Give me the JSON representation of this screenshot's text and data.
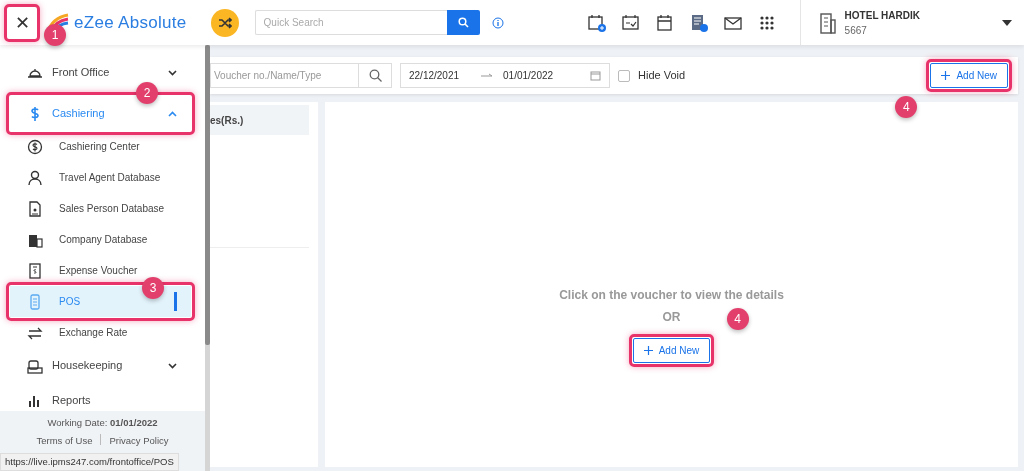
{
  "header": {
    "close_callout": "1",
    "close_symbol": "✕",
    "brand": "eZee Absolute",
    "search": {
      "placeholder": "Quick Search"
    },
    "hotel": {
      "name": "HOTEL HARDIK",
      "code": "5667"
    }
  },
  "sidebar": {
    "items": [
      {
        "label": "Front Office",
        "expanded": false
      },
      {
        "label": "Cashiering",
        "expanded": true,
        "callout": "2",
        "children": [
          {
            "label": "Cashiering Center",
            "selected": false
          },
          {
            "label": "Travel Agent Database",
            "selected": false
          },
          {
            "label": "Sales Person Database",
            "selected": false
          },
          {
            "label": "Company Database",
            "selected": false
          },
          {
            "label": "Expense Voucher",
            "selected": false
          },
          {
            "label": "POS",
            "selected": true,
            "callout": "3"
          },
          {
            "label": "Exchange Rate",
            "selected": false
          }
        ]
      },
      {
        "label": "Housekeeping",
        "expanded": false
      },
      {
        "label": "Reports"
      }
    ],
    "footer": {
      "working_date_label": "Working Date:",
      "working_date": "01/01/2022",
      "links": [
        "Terms of Use",
        "Privacy Policy"
      ]
    }
  },
  "status_url": "https://live.ipms247.com/frontoffice/POS",
  "toolbar": {
    "search_placeholder": "Voucher no./Name/Type",
    "date_from": "22/12/2021",
    "date_to": "01/01/2022",
    "hide_void": {
      "label": "Hide Void",
      "checked": false
    },
    "add_button": {
      "label": "Add New",
      "callout": "4"
    }
  },
  "list_panel": {
    "column_header": "es(Rs.)"
  },
  "detail": {
    "message": "Click on the voucher to view the details",
    "or": "OR",
    "add_button": {
      "label": "Add New",
      "callout": "4"
    }
  }
}
